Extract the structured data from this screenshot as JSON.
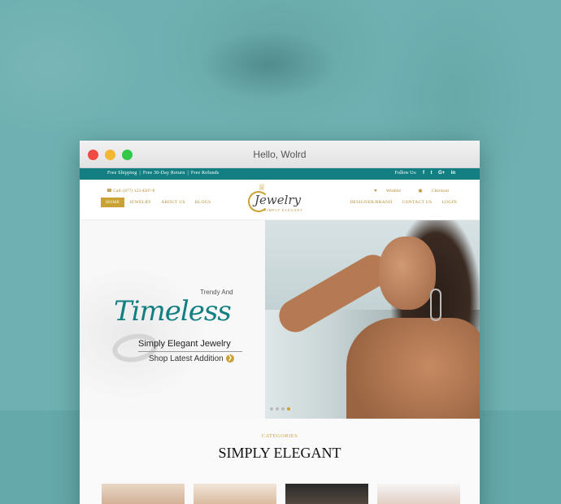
{
  "window": {
    "title": "Hello, Wolrd"
  },
  "topbar": {
    "left_items": [
      "Free Shipping",
      "Free 30-Day Return",
      "Free Refunds"
    ],
    "follow_label": "Follow Us:",
    "social": [
      "f-icon",
      "twitter-icon",
      "google-plus-icon",
      "linkedin-icon"
    ],
    "social_glyphs": [
      "f",
      "t",
      "G+",
      "in"
    ]
  },
  "header": {
    "phone": "Call: (877) 123-4567-8",
    "wishlist": "Wishlist",
    "checkout": "Checkout",
    "nav_left": [
      "HOME",
      "JEWELRY",
      "ABOUT US",
      "BLOGS"
    ],
    "nav_right": [
      "DESIGNER/BRAND",
      "CONTACT US",
      "LOGIN"
    ],
    "logo_text": "Jewelry",
    "logo_sub": "SIMPLY ELEGANT"
  },
  "hero": {
    "kicker": "Trendy And",
    "headline": "Timeless",
    "subtitle": "Simply Elegant Jewelry",
    "cta": "Shop Latest Addition",
    "slides": 4,
    "active_slide": 4
  },
  "categories": {
    "label": "CATEGORIES",
    "title": "SIMPLY ELEGANT"
  },
  "colors": {
    "teal": "#137f82",
    "gold": "#c9a233",
    "background": "#6fb1b2"
  }
}
